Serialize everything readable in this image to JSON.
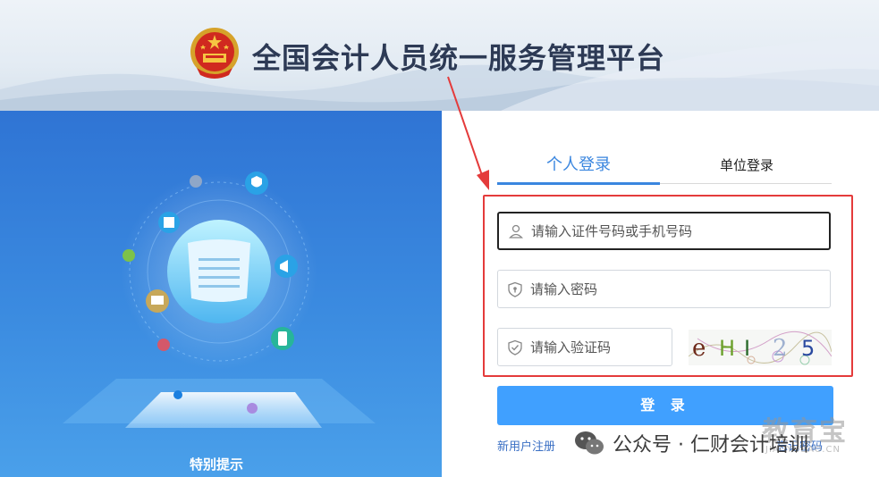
{
  "header": {
    "title": "全国会计人员统一服务管理平台"
  },
  "left_panel": {
    "tip_title": "特别提示"
  },
  "login": {
    "tabs": [
      {
        "label": "个人登录",
        "active": true
      },
      {
        "label": "单位登录",
        "active": false
      }
    ],
    "id_placeholder": "请输入证件号码或手机号码",
    "password_placeholder": "请输入密码",
    "captcha_placeholder": "请输入验证码",
    "captcha_text": "eHI 25",
    "submit_label": "登 录",
    "register_label": "新用户注册",
    "forgot_label": "忘记密码"
  },
  "watermark": {
    "wechat_text": "公众号 · 仁财会计培训",
    "logo_text": "教育宝",
    "logo_sub": "JIAOYUBAO.CN"
  },
  "colors": {
    "accent": "#3a86df",
    "button": "#40a0ff",
    "highlight": "#e43b3b",
    "panel_blue": "#3b8be0"
  },
  "icons": [
    "national-emblem-icon",
    "user-icon",
    "shield-lock-icon",
    "shield-check-icon",
    "wechat-icon"
  ]
}
